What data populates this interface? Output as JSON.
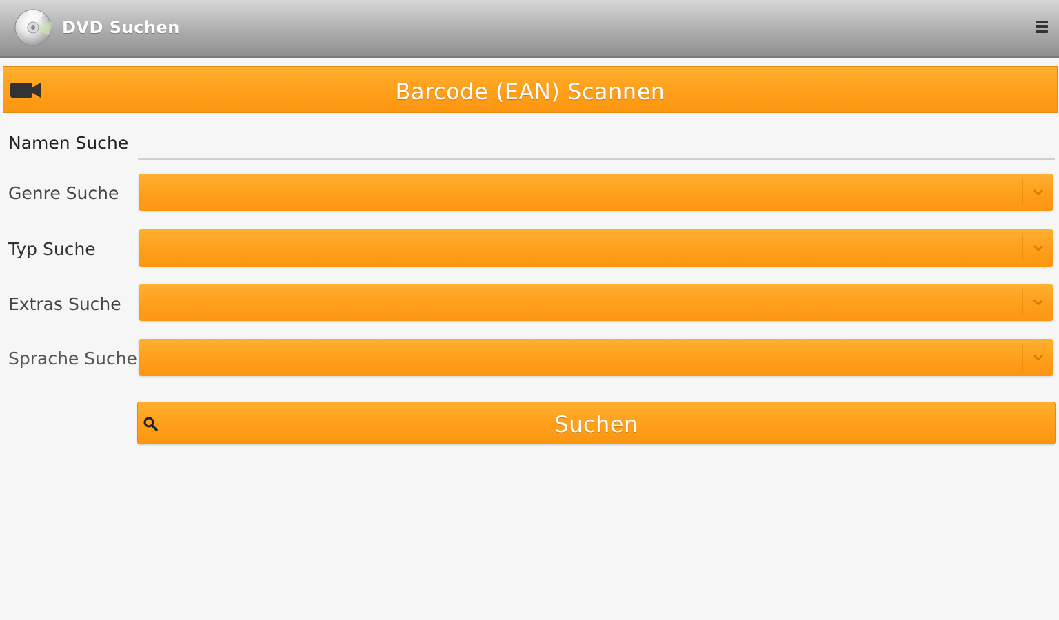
{
  "header": {
    "app_icon": "dvd-disc-icon",
    "title": "DVD Suchen",
    "menu_icon": "overflow-menu-icon"
  },
  "scan": {
    "icon": "video-camera-icon",
    "label": "Barcode (EAN) Scannen"
  },
  "form": {
    "name_label": "Namen Suche",
    "name_value": "",
    "genre_label": "Genre Suche",
    "genre_value": "",
    "typ_label": "Typ Suche",
    "typ_value": "",
    "extras_label": "Extras Suche",
    "extras_value": "",
    "sprache_label": "Sprache Suche",
    "sprache_value": ""
  },
  "search": {
    "icon": "search-icon",
    "label": "Suchen"
  },
  "colors": {
    "accent": "#ffa01c",
    "header_bg": "#a9a9a9",
    "background": "#f6f6f6"
  }
}
